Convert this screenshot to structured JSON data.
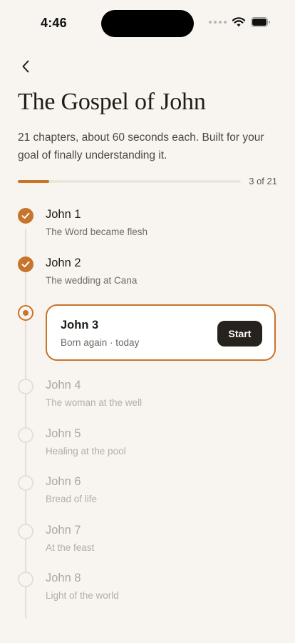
{
  "status_bar": {
    "time": "4:46"
  },
  "header": {
    "title": "The Gospel of John",
    "subtitle": "21 chapters, about 60 seconds each. Built for your goal of finally understanding it."
  },
  "progress": {
    "label": "3 of 21",
    "current": 3,
    "total": 21,
    "fill_fraction": 0.142
  },
  "chapters": [
    {
      "title": "John 1",
      "subtitle": "The Word became flesh",
      "status": "completed"
    },
    {
      "title": "John 2",
      "subtitle": "The wedding at Cana",
      "status": "completed"
    },
    {
      "title": "John 3",
      "subtitle": "Born again · today",
      "status": "current",
      "action_label": "Start"
    },
    {
      "title": "John 4",
      "subtitle": "The woman at the well",
      "status": "locked"
    },
    {
      "title": "John 5",
      "subtitle": "Healing at the pool",
      "status": "locked"
    },
    {
      "title": "John 6",
      "subtitle": "Bread of life",
      "status": "locked"
    },
    {
      "title": "John 7",
      "subtitle": "At the feast",
      "status": "locked"
    },
    {
      "title": "John 8",
      "subtitle": "Light of the world",
      "status": "locked"
    }
  ],
  "colors": {
    "accent": "#C8742A",
    "background": "#F8F5F0",
    "button": "#26221E"
  },
  "icons": [
    "back-chevron-icon",
    "wifi-icon",
    "battery-icon",
    "check-icon"
  ]
}
